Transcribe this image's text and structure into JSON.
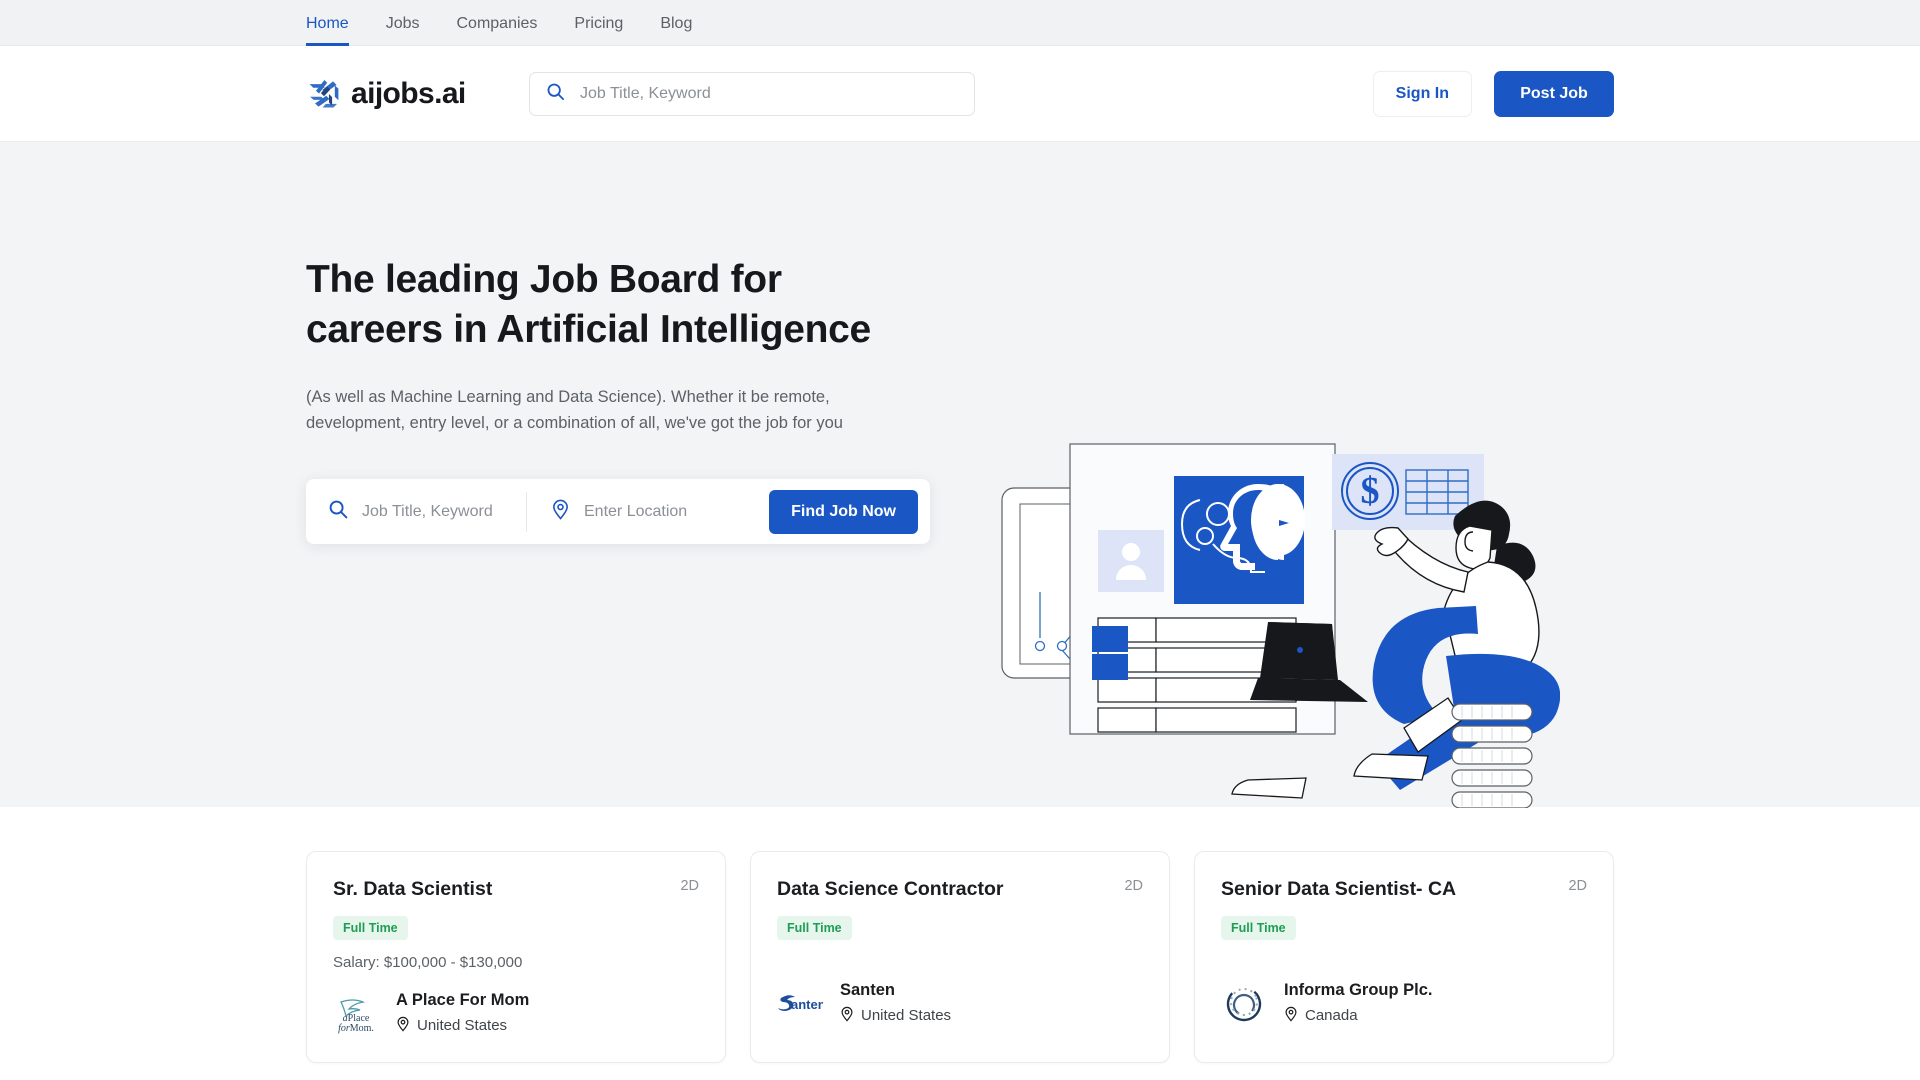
{
  "topnav": {
    "items": [
      {
        "label": "Home",
        "active": true
      },
      {
        "label": "Jobs",
        "active": false
      },
      {
        "label": "Companies",
        "active": false
      },
      {
        "label": "Pricing",
        "active": false
      },
      {
        "label": "Blog",
        "active": false
      }
    ]
  },
  "header": {
    "logo_text": "aijobs.ai",
    "search_placeholder": "Job Title, Keyword",
    "sign_in_label": "Sign In",
    "post_job_label": "Post Job"
  },
  "hero": {
    "title_line1": "The leading Job Board for",
    "title_line2": "careers in Artificial Intelligence",
    "subtitle": "(As well as Machine Learning and Data Science). Whether it be remote, development, entry level, or a combination of all, we've got the job for you",
    "keyword_placeholder": "Job Title, Keyword",
    "location_placeholder": "Enter Location",
    "find_label": "Find Job Now"
  },
  "jobs": [
    {
      "title": "Sr. Data Scientist",
      "age": "2D",
      "badge": "Full Time",
      "salary": "Salary: $100,000 - $130,000",
      "company": "A Place For Mom",
      "location": "United States",
      "logo": "a-place-for-mom-logo"
    },
    {
      "title": "Data Science Contractor",
      "age": "2D",
      "badge": "Full Time",
      "salary": "",
      "company": "Santen",
      "location": "United States",
      "logo": "santen-logo"
    },
    {
      "title": "Senior Data Scientist- CA",
      "age": "2D",
      "badge": "Full Time",
      "salary": "",
      "company": "Informa Group Plc.",
      "location": "Canada",
      "logo": "informa-logo"
    }
  ],
  "colors": {
    "brand_blue": "#1a56c4",
    "topbar_bg": "#f1f2f4",
    "hero_bg": "#f3f4f6",
    "badge_green_text": "#1f9d55",
    "badge_green_bg": "#e6f6ec",
    "muted_text": "#5b6166"
  }
}
